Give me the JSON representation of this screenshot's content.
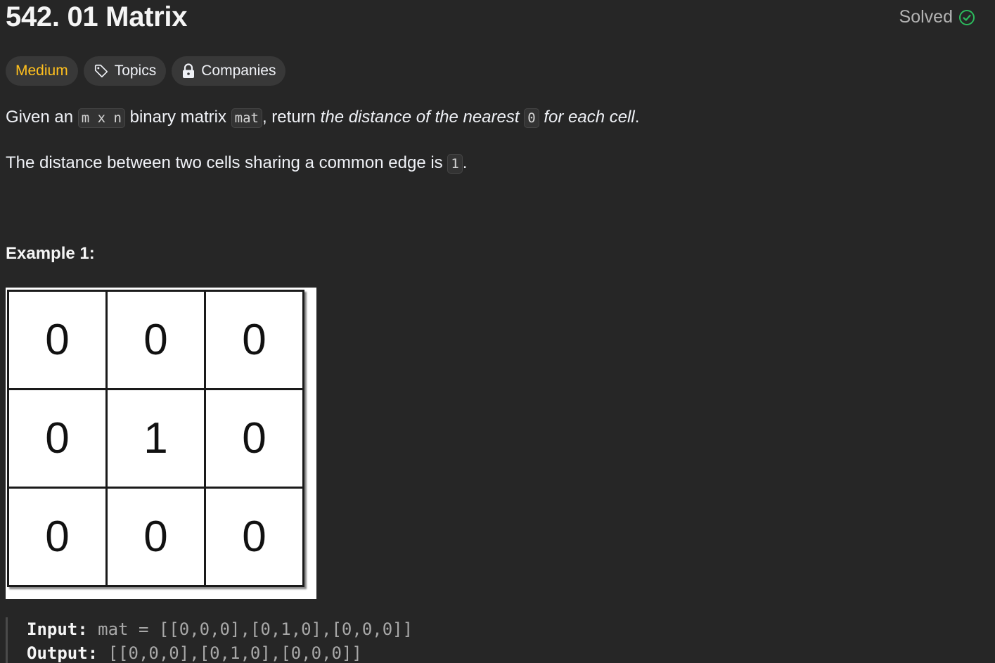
{
  "problem": {
    "title": "542. 01 Matrix",
    "status": "Solved",
    "status_color": "#2cbb5d"
  },
  "tags": {
    "difficulty": "Medium",
    "difficulty_color": "#ffc01e",
    "topics": "Topics",
    "topics_icon": "tag-icon",
    "companies": "Companies",
    "companies_icon": "lock-icon"
  },
  "description": {
    "p1": {
      "t1": "Given an ",
      "c1": "m x n",
      "t2": " binary matrix ",
      "c2": "mat",
      "t3": ", return ",
      "e1": "the distance of the nearest ",
      "c3": "0",
      "e2": " for each cell",
      "t4": "."
    },
    "p2": {
      "t1": "The distance between two cells sharing a common edge is ",
      "c1": "1",
      "t2": "."
    }
  },
  "example": {
    "title": "Example 1:",
    "matrix": [
      [
        "0",
        "0",
        "0"
      ],
      [
        "0",
        "1",
        "0"
      ],
      [
        "0",
        "0",
        "0"
      ]
    ],
    "input_label": "Input:",
    "input_value": " mat = [[0,0,0],[0,1,0],[0,0,0]]",
    "output_label": "Output:",
    "output_value": " [[0,0,0],[0,1,0],[0,0,0]]"
  }
}
